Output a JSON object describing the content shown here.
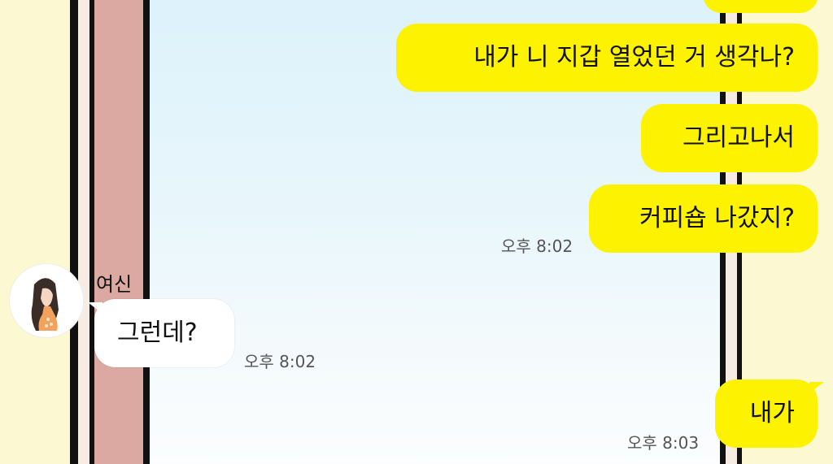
{
  "chat": {
    "messages": [
      {
        "id": "m0",
        "direction": "out",
        "text": ""
      },
      {
        "id": "m1",
        "direction": "out",
        "text": "내가 니 지갑 열었던 거 생각나?"
      },
      {
        "id": "m2",
        "direction": "out",
        "text": "그리고나서"
      },
      {
        "id": "m3",
        "direction": "out",
        "text": "커피숍 나갔지?",
        "time": "오후 8:02"
      },
      {
        "id": "m4",
        "direction": "in",
        "sender": "여신",
        "text": "그런데?",
        "time": "오후 8:02"
      },
      {
        "id": "m5",
        "direction": "out",
        "text": "내가",
        "time": "오후 8:03"
      }
    ]
  },
  "colors": {
    "outgoing_bubble": "#fdf200",
    "incoming_bubble": "#ffffff",
    "background_sky": "#ddf2fb",
    "side_panel": "#fbf8d2"
  },
  "avatar": {
    "icon": "girl-profile-icon"
  }
}
